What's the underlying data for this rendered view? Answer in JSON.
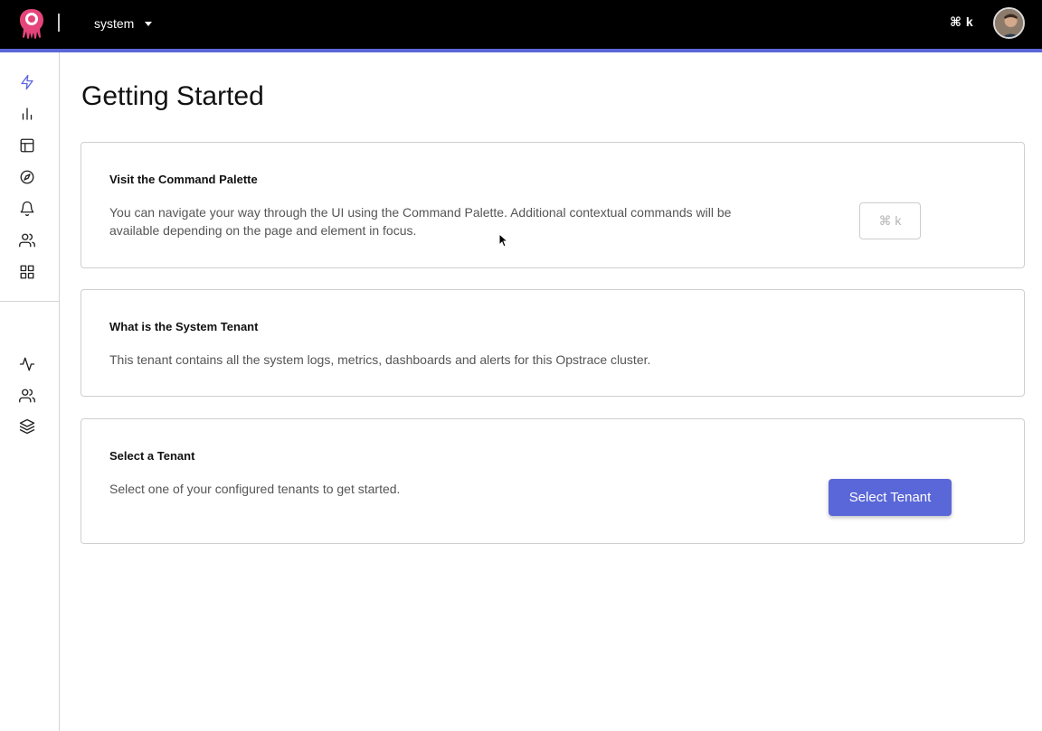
{
  "topbar": {
    "tenant_name": "system",
    "shortcut_hint": "⌘ k"
  },
  "colors": {
    "accent": "#5a67d8",
    "topbar_bg": "#000000",
    "logo": "#e5457a"
  },
  "sidebar": {
    "primary_items": [
      {
        "icon": "lightning-icon",
        "active": true
      },
      {
        "icon": "bar-chart-icon",
        "active": false
      },
      {
        "icon": "layout-icon",
        "active": false
      },
      {
        "icon": "compass-icon",
        "active": false
      },
      {
        "icon": "bell-icon",
        "active": false
      },
      {
        "icon": "users-icon",
        "active": false
      },
      {
        "icon": "grid-icon",
        "active": false
      }
    ],
    "secondary_items": [
      {
        "icon": "activity-icon",
        "active": false
      },
      {
        "icon": "users-icon",
        "active": false
      },
      {
        "icon": "layers-icon",
        "active": false
      }
    ]
  },
  "main": {
    "title": "Getting Started",
    "cards": [
      {
        "heading": "Visit the Command Palette",
        "body": "You can navigate your way through the UI using the Command Palette. Additional contextual commands will be available depending on the page and element in focus.",
        "button_label": "⌘ k"
      },
      {
        "heading": "What is the System Tenant",
        "body": "This tenant contains all the system logs, metrics, dashboards and alerts for this Opstrace cluster."
      },
      {
        "heading": "Select a Tenant",
        "body": "Select one of your configured tenants to get started.",
        "button_label": "Select Tenant"
      }
    ]
  }
}
